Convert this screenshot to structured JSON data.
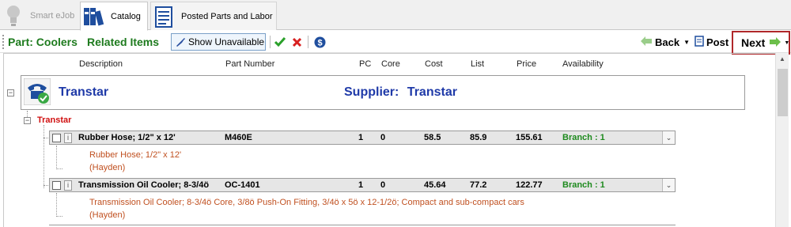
{
  "tabs": [
    {
      "label": "Smart eJob"
    },
    {
      "label": "Catalog"
    },
    {
      "label": "Posted Parts and Labor"
    }
  ],
  "toolbar": {
    "part_label": "Part: Coolers",
    "related_label": "Related Items",
    "show_unavailable_label": "Show Unavailable",
    "back_label": "Back",
    "post_label": "Post",
    "next_label": "Next"
  },
  "columns": [
    "Description",
    "Part Number",
    "PC",
    "Core",
    "Cost",
    "List",
    "Price",
    "Availability"
  ],
  "supplier": {
    "name": "Transtar",
    "label": "Supplier:",
    "value": "Transtar"
  },
  "group": {
    "name": "Transtar"
  },
  "rows": [
    {
      "description": "Rubber Hose; 1/2\" x 12'",
      "part_number": "M460E",
      "pc": "1",
      "core": "0",
      "cost": "58.5",
      "list": "85.9",
      "price": "155.61",
      "availability": "Branch : 1",
      "detail": "Rubber Hose; 1/2\" x 12'",
      "brand": "(Hayden)"
    },
    {
      "description": "Transmission Oil Cooler; 8-3/4ö",
      "part_number": "OC-1401",
      "pc": "1",
      "core": "0",
      "cost": "45.64",
      "list": "77.2",
      "price": "122.77",
      "availability": "Branch : 1",
      "detail": "Transmission Oil Cooler; 8-3/4ö Core, 3/8ö Push-On Fitting, 3/4ö x 5ö x 12-1/2ö; Compact and sub-compact cars",
      "brand": "(Hayden)"
    }
  ],
  "colors": {
    "accent_green": "#1e7b1e",
    "supplier_blue": "#1f3aa8",
    "group_red": "#d01010",
    "detail_orange": "#c05020",
    "highlight_border": "#b0282a"
  }
}
